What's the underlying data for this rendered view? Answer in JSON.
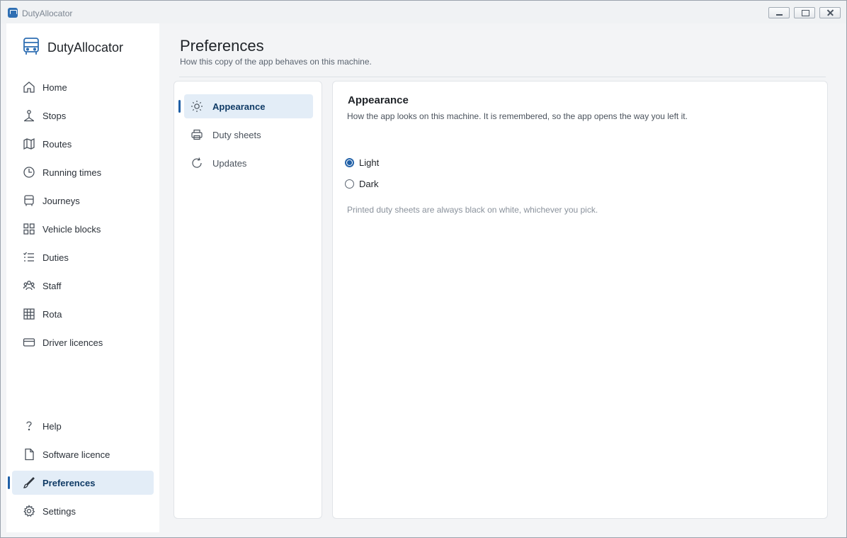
{
  "window": {
    "title": "DutyAllocator"
  },
  "sidebar": {
    "brand": "DutyAllocator",
    "items": [
      {
        "label": "Home",
        "icon": "home-icon"
      },
      {
        "label": "Stops",
        "icon": "stop-sign-icon"
      },
      {
        "label": "Routes",
        "icon": "map-icon"
      },
      {
        "label": "Running times",
        "icon": "clock-icon"
      },
      {
        "label": "Journeys",
        "icon": "bus-icon"
      },
      {
        "label": "Vehicle blocks",
        "icon": "grid-icon"
      },
      {
        "label": "Duties",
        "icon": "checklist-icon"
      },
      {
        "label": "Staff",
        "icon": "people-icon"
      },
      {
        "label": "Rota",
        "icon": "table-icon"
      },
      {
        "label": "Driver licences",
        "icon": "card-icon"
      }
    ],
    "bottom_items": [
      {
        "label": "Help",
        "icon": "question-icon"
      },
      {
        "label": "Software licence",
        "icon": "document-icon"
      },
      {
        "label": "Preferences",
        "icon": "brush-icon",
        "active": true
      },
      {
        "label": "Settings",
        "icon": "gear-icon"
      }
    ]
  },
  "page": {
    "title": "Preferences",
    "subtitle": "How this copy of the app behaves on this machine."
  },
  "subnav": {
    "items": [
      {
        "label": "Appearance",
        "icon": "sun-icon",
        "active": true
      },
      {
        "label": "Duty sheets",
        "icon": "printer-icon"
      },
      {
        "label": "Updates",
        "icon": "refresh-icon"
      }
    ]
  },
  "panel": {
    "title": "Appearance",
    "description": "How the app looks on this machine. It is remembered, so the app opens the way you left it.",
    "options": [
      {
        "label": "Light",
        "checked": true
      },
      {
        "label": "Dark",
        "checked": false
      }
    ],
    "note": "Printed duty sheets are always black on white, whichever you pick."
  },
  "colors": {
    "accent": "#1f5fa6",
    "active_bg": "#e3edf7",
    "active_text": "#103b66"
  }
}
